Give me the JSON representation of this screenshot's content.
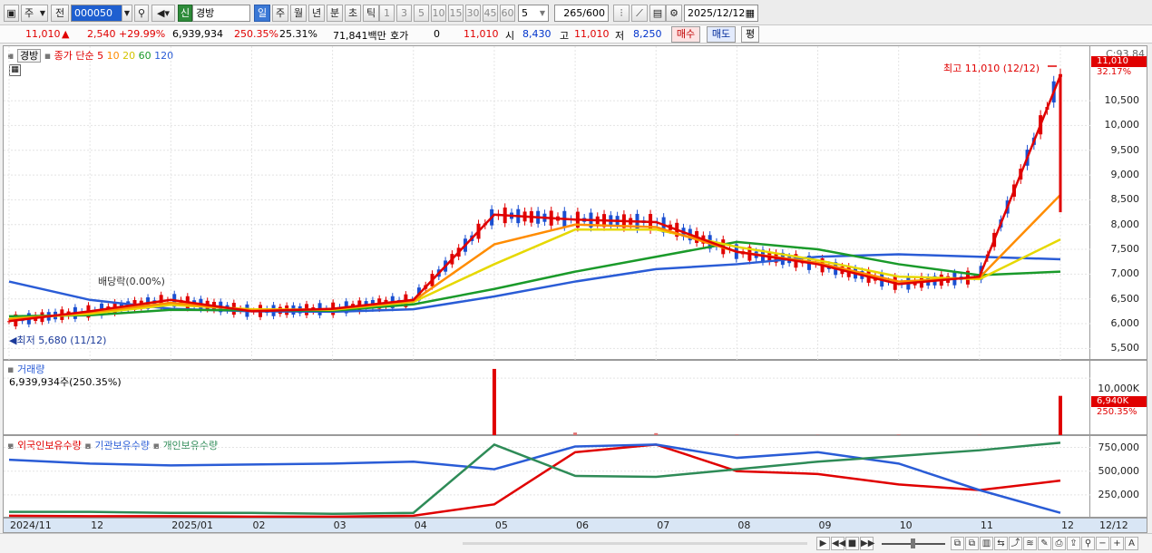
{
  "toolbar": {
    "type_label": "주",
    "prev_label": "전",
    "code_value": "000050",
    "signal_label": "신",
    "name_value": "경방",
    "periods": [
      "일",
      "주",
      "월",
      "년",
      "분",
      "초",
      "틱"
    ],
    "minute_ticks": [
      "1",
      "3",
      "5",
      "10",
      "15",
      "30",
      "45",
      "60"
    ],
    "count_value": "5",
    "page_count": "265",
    "page_total": "/600",
    "date_value": "2025/12/12"
  },
  "quote": {
    "price": "11,010",
    "change": "2,540",
    "change_pct": "+29.99%",
    "volume": "6,939,934",
    "volume_ratio": "250.35%",
    "turnover": "25.31%",
    "amount": "71,841백만",
    "hoga_label": "호가",
    "hoga_value": "0",
    "hoga_price": "11,010",
    "open_label": "시",
    "open": "8,430",
    "high_label": "고",
    "high": "11,010",
    "low_label": "저",
    "low": "8,250",
    "buy_label": "매수",
    "sell_label": "매도",
    "avg_label": "평"
  },
  "price_panel": {
    "name": "경방",
    "ma_prefix": "종가 단순",
    "ma_periods": [
      "5",
      "10",
      "20",
      "60",
      "120"
    ],
    "high_annotation": "최고 11,010 (12/12)",
    "low_annotation": "최저 5,680 (11/12)",
    "dividend_annotation": "배당락(0.00%)",
    "y_ticks": [
      "10,500",
      "10,000",
      "9,500",
      "9,000",
      "8,500",
      "8,000",
      "7,500",
      "7,000",
      "6,500",
      "6,000",
      "5,500"
    ],
    "y_range": [
      5250,
      11600
    ],
    "cr_label": "C:93.84",
    "price_tag": "11,010",
    "pct_tag": "32.17%"
  },
  "volume_panel": {
    "title": "거래량",
    "info": "6,939,934주(250.35%)",
    "y_ticks": [
      "10,000K"
    ],
    "tag": "6,940K",
    "pct_tag": "250.35%"
  },
  "holding_panel": {
    "foreign_label": "외국인보유수량",
    "inst_label": "기관보유수량",
    "indiv_label": "개인보유수량",
    "y_ticks": [
      "750,000",
      "500,000",
      "250,000"
    ]
  },
  "xaxis": {
    "labels": [
      "2024/11",
      "12",
      "2025/01",
      "02",
      "03",
      "04",
      "05",
      "06",
      "07",
      "08",
      "09",
      "10",
      "11",
      "12"
    ],
    "end_label": "12/12"
  },
  "chart_data": [
    {
      "type": "candlestick",
      "title": "경방",
      "x": [
        "2024/11",
        "2024/12",
        "2025/01",
        "2025/02",
        "2025/03",
        "2025/04",
        "2025/05",
        "2025/06",
        "2025/07",
        "2025/08",
        "2025/09",
        "2025/10",
        "2025/11",
        "2025/12"
      ],
      "series": [
        {
          "name": "5",
          "values": [
            6050,
            6250,
            6480,
            6250,
            6300,
            6480,
            8200,
            8100,
            8050,
            7450,
            7200,
            6800,
            6950,
            11010
          ]
        },
        {
          "name": "10",
          "values": [
            6080,
            6230,
            6420,
            6270,
            6290,
            6460,
            7600,
            8000,
            7950,
            7450,
            7230,
            6850,
            6930,
            8600
          ]
        },
        {
          "name": "20",
          "values": [
            6100,
            6200,
            6380,
            6290,
            6280,
            6440,
            7200,
            7900,
            7900,
            7550,
            7280,
            6950,
            6900,
            7700
          ]
        },
        {
          "name": "60",
          "values": [
            6150,
            6170,
            6280,
            6270,
            6260,
            6390,
            6700,
            7050,
            7350,
            7650,
            7500,
            7200,
            6980,
            7050
          ]
        },
        {
          "name": "120",
          "values": [
            6850,
            6480,
            6300,
            6250,
            6240,
            6290,
            6550,
            6850,
            7100,
            7200,
            7350,
            7400,
            7350,
            7300
          ]
        }
      ],
      "high": {
        "label": "최고 11,010 (12/12)",
        "value": 11010
      },
      "low": {
        "label": "최저 5,680 (11/12)",
        "value": 5680
      },
      "ylim": [
        5250,
        11600
      ]
    },
    {
      "type": "bar",
      "title": "거래량",
      "x": [
        "2024/11",
        "2024/12",
        "2025/01",
        "2025/02",
        "2025/03",
        "2025/04",
        "2025/05",
        "2025/06",
        "2025/07",
        "2025/08",
        "2025/09",
        "2025/10",
        "2025/11",
        "2025/12"
      ],
      "values_k": [
        80,
        90,
        100,
        60,
        70,
        120,
        11600,
        600,
        500,
        250,
        200,
        250,
        200,
        6940
      ],
      "ylim": [
        0,
        13000
      ]
    },
    {
      "type": "line",
      "title": "보유수량",
      "x": [
        "2024/11",
        "2024/12",
        "2025/01",
        "2025/02",
        "2025/03",
        "2025/04",
        "2025/05",
        "2025/06",
        "2025/07",
        "2025/08",
        "2025/09",
        "2025/10",
        "2025/11",
        "2025/12"
      ],
      "series": [
        {
          "name": "외국인보유수량",
          "color": "#e00000",
          "values": [
            30000,
            25000,
            25000,
            20000,
            20000,
            30000,
            150000,
            700000,
            780000,
            500000,
            470000,
            360000,
            300000,
            400000
          ]
        },
        {
          "name": "기관보유수량",
          "color": "#2a5cd6",
          "values": [
            620000,
            580000,
            560000,
            570000,
            580000,
            600000,
            520000,
            760000,
            780000,
            640000,
            700000,
            580000,
            300000,
            60000
          ]
        },
        {
          "name": "개인보유수량",
          "color": "#2e8b57",
          "values": [
            70000,
            70000,
            60000,
            60000,
            50000,
            60000,
            780000,
            450000,
            440000,
            520000,
            600000,
            660000,
            720000,
            800000
          ]
        }
      ],
      "ylim": [
        0,
        870000
      ]
    }
  ],
  "colors": {
    "up": "#e00000",
    "down": "#1b4fd1",
    "ma5": "#e00000",
    "ma10": "#ff8c00",
    "ma20": "#e6d800",
    "ma60": "#1a9a2a",
    "ma120": "#2a5cd6"
  }
}
